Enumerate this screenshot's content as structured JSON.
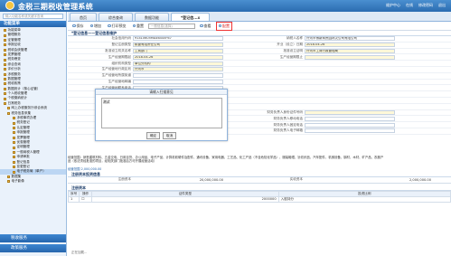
{
  "app": {
    "title": "金税三期税收管理系统",
    "header_links": [
      "维护中心",
      "在线",
      "修改密码",
      "退出"
    ]
  },
  "sidebar": {
    "search_placeholder": "输入功能名称或关键字查询",
    "section": "功能菜单",
    "items": [
      {
        "label": "功能菜单",
        "sel": false
      },
      {
        "label": "管理服务",
        "sel": false
      },
      {
        "label": "征管管理",
        "sel": false
      },
      {
        "label": "申报征收",
        "sel": false
      },
      {
        "label": "税收会统管理",
        "sel": false
      },
      {
        "label": "发票管理",
        "sel": false
      },
      {
        "label": "税务稽查",
        "sel": false
      },
      {
        "label": "综合查询",
        "sel": false
      },
      {
        "label": "评价分析",
        "sel": false
      },
      {
        "label": "涉税服务",
        "sel": false
      },
      {
        "label": "数据管理",
        "sel": false
      },
      {
        "label": "税收政策",
        "sel": false
      },
      {
        "label": "数据统计（核心征管）",
        "sel": false
      },
      {
        "label": "个人税收管理",
        "sel": false
      },
      {
        "label": "个税缴纳统计",
        "sel": false
      },
      {
        "label": "日常税务",
        "sel": false
      },
      {
        "label": "网上办税服务厅综合系统",
        "sel": false
      },
      {
        "label": "税务信息采集",
        "sel": false
      },
      {
        "label": "涉税事项办理",
        "sel": false
      },
      {
        "label": "税务登记",
        "sel": false
      },
      {
        "label": "认定管理",
        "sel": false
      },
      {
        "label": "申报管理",
        "sel": false
      },
      {
        "label": "发票管理",
        "sel": false
      },
      {
        "label": "优惠管理",
        "sel": false
      },
      {
        "label": "证明管理",
        "sel": false
      },
      {
        "label": "一般纳税人管理",
        "sel": false
      },
      {
        "label": "申请审批",
        "sel": false
      },
      {
        "label": "登记信息",
        "sel": false
      },
      {
        "label": "变更登记",
        "sel": false
      },
      {
        "label": "电子税务局（单户）",
        "sel": true
      },
      {
        "label": "数据集",
        "sel": false
      },
      {
        "label": "电子影像",
        "sel": false
      }
    ],
    "footer_items": [
      "税收服务",
      "政策服务"
    ]
  },
  "tabs": [
    "首页",
    "综合查询",
    "数据功能",
    "*登记信...x"
  ],
  "toolbar": {
    "items": [
      "保存",
      "增加",
      "打印预览",
      "重置",
      "一般信息(选择)",
      "查看",
      "配置"
    ],
    "search_placeholder": "一般信息(选择)"
  },
  "form": {
    "section_title": "*登记信息——登记信息维护",
    "rows": [
      {
        "l1": "社会信用代码",
        "v1": "91410605MA46445F67",
        "l2": "纳税人名称",
        "v2": "许河市博新商贸园林灾公司有限公司",
        "y1": false,
        "y2": false
      },
      {
        "l1": "登记注册类型",
        "v1": "私营有限责任公司",
        "l2": "开业（设立）日期",
        "v2": "2018-04-26",
        "y1": true,
        "y2": true
      },
      {
        "l1": "批准设立机关名称",
        "v1": "工商部门",
        "l2": "批准设立证明",
        "v2": "许河市工商行政管理局",
        "y1": true,
        "y2": true
      },
      {
        "l1": "生产经营期限起",
        "v1": "2018-04-26",
        "l2": "生产经营期限止",
        "v2": "",
        "y1": true,
        "y2": true
      },
      {
        "l1": "组织机构类型",
        "v1": "单位分机构",
        "l2": "",
        "v2": "",
        "y1": true,
        "y2": false
      },
      {
        "l1": "生产经营地行政区划",
        "v1": "许河市",
        "l2": "",
        "v2": "",
        "y1": true,
        "y2": false
      },
      {
        "l1": "生产经营地所属街道",
        "v1": "",
        "l2": "",
        "v2": "",
        "y1": false,
        "y2": false
      },
      {
        "l1": "生产经营地邮编",
        "v1": "",
        "l2": "",
        "v2": "",
        "y1": false,
        "y2": false
      },
      {
        "l1": "生产经营地联系电话",
        "v1": "",
        "l2": "",
        "v2": "",
        "y1": false,
        "y2": false
      },
      {
        "l1": "生产经营地址",
        "v1": "许河市...",
        "l2": "",
        "v2": "",
        "y1": true,
        "y2": false
      },
      {
        "l1": "注册地行政区划",
        "v1": "",
        "l2": "",
        "v2": "",
        "y1": true,
        "y2": false
      },
      {
        "l1": "法定代表人身份证件种类",
        "v1": "居民身份证",
        "l2": "",
        "v2": "",
        "y1": true,
        "y2": false
      },
      {
        "l1": "法定代表人身份证件号码",
        "v1": "",
        "l2": "财务负责人身份证件号码",
        "v2": "",
        "y1": true,
        "y2": true
      },
      {
        "l1": "法定代表人移动电话",
        "v1": "",
        "l2": "财务负责人移动电话",
        "v2": "",
        "y1": false,
        "y2": false
      },
      {
        "l1": "法定代表人固定电话",
        "v1": "",
        "l2": "财务负责人固定电话",
        "v2": "",
        "y1": false,
        "y2": false
      },
      {
        "l1": "法定代表人电子邮箱",
        "v1": "",
        "l2": "财务负责人电子邮箱",
        "v2": "",
        "y1": false,
        "y2": false
      }
    ]
  },
  "popup": {
    "title": "请输入扫描意见",
    "text": "测试",
    "ok": "确定",
    "cancel": "取消"
  },
  "note": "经营范围：销售建筑材料、五金交电、日用百货、办公用品、电子产品、计算机软硬件及配件、通讯设备、家用电器、工艺品、化工产品（不含危险化学品）、服装鞋帽、针纺织品、汽车配件、机械设备、钢材、木材、矿产品、农副产品（依法须经批准的项目，经相关部门批准后方可开展经营活动）",
  "note_link": "经营范围 2,000,000.00",
  "capital": {
    "section": "注册资本投资信息",
    "label_a": "注册资本",
    "value_a": "20,000,000.00",
    "label_b": "实收资本",
    "value_b": "2,000,000.00"
  },
  "investors": {
    "section": "注册资本",
    "headers": [
      "序号",
      "操作",
      "证件类型",
      "投资比例"
    ],
    "rows": [
      {
        "no": "1",
        "type": "2000000",
        "ratio": "入股持分"
      }
    ]
  },
  "status": "正在加载..."
}
